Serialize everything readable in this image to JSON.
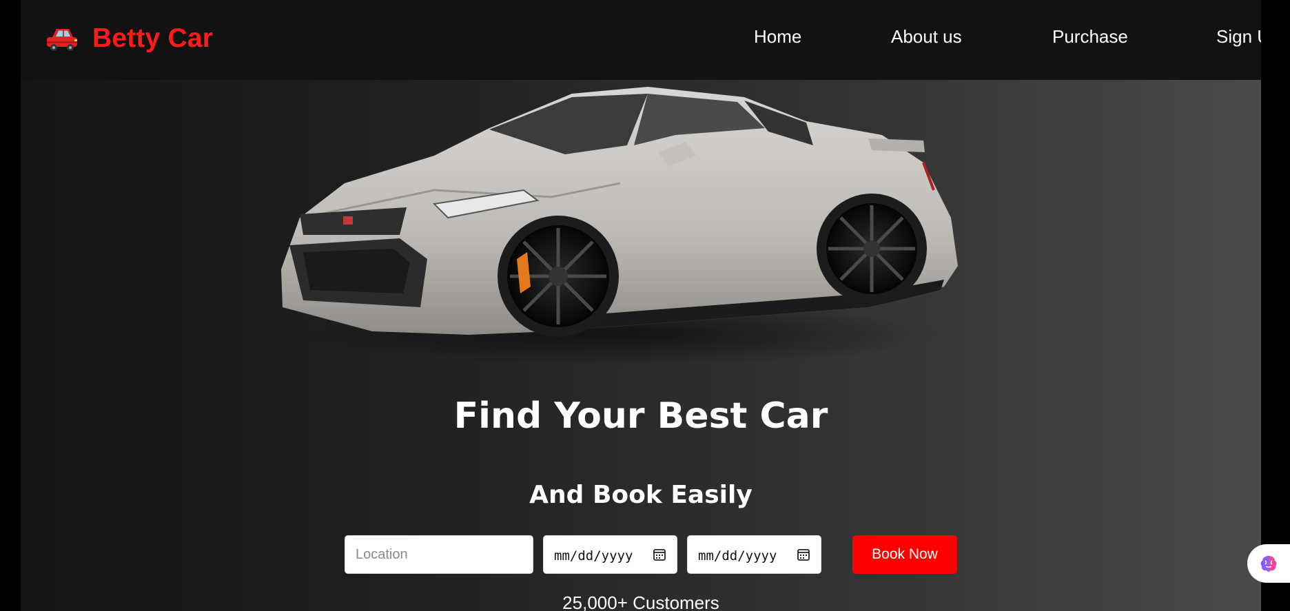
{
  "brand": {
    "name": "Betty Car",
    "icon": "car-icon"
  },
  "nav": {
    "items": [
      "Home",
      "About us",
      "Purchase",
      "Sign Up"
    ]
  },
  "hero": {
    "title": "Find Your Best Car",
    "subtitle": "And Book Easily",
    "image": "sports-car-image"
  },
  "booking": {
    "location_placeholder": "Location",
    "pickup_date_placeholder": "mm/dd/yyyy",
    "return_date_placeholder": "mm/dd/yyyy",
    "button_label": "Book Now"
  },
  "stats": {
    "customers": "25,000+ Customers"
  },
  "colors": {
    "accent": "#ff0000",
    "navbar": "#121212",
    "text": "#ffffff"
  },
  "widget": {
    "icon": "brain-icon"
  }
}
